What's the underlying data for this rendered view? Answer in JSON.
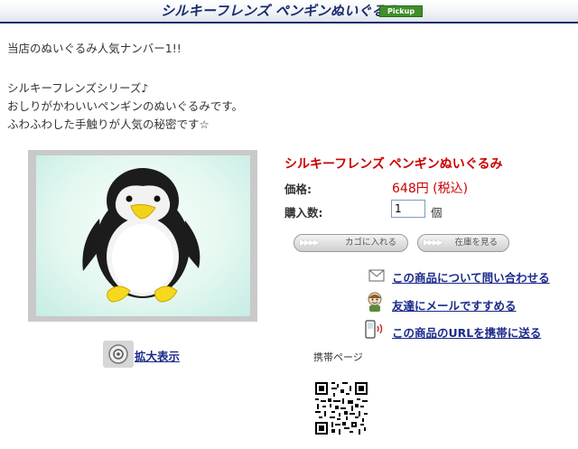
{
  "header": {
    "title": "シルキーフレンズ ペンギンぬいぐるみ",
    "badge": "Pickup"
  },
  "intro": {
    "line1": "当店のぬいぐるみ人気ナンバー1!!",
    "line2": "シルキーフレンズシリーズ♪",
    "line3": "おしりがかわいいペンギンのぬいぐるみです。",
    "line4": "ふわふわした手触りが人気の秘密です☆"
  },
  "product": {
    "name": "シルキーフレンズ ペンギンぬいぐるみ",
    "price_label": "価格:",
    "price_value": "648円 (税込)",
    "qty_label": "購入数:",
    "qty_value": "1",
    "qty_unit": "個"
  },
  "buttons": {
    "cart": "カゴに入れる",
    "stock": "在庫を見る"
  },
  "links": {
    "inquiry": "この商品について問い合わせる",
    "recommend": "友達にメールですすめる",
    "mobile_url": "この商品のURLを携帯に送る",
    "zoom": "拡大表示"
  },
  "mobile": {
    "label": "携帯ページ"
  },
  "colors": {
    "header_navy": "#1a2c6e",
    "badge_green": "#3f8f2a",
    "price_red": "#cc0000",
    "link_blue": "#1a2a8a"
  },
  "icons": [
    "envelope-icon",
    "person-icon",
    "mobile-phone-icon",
    "zoom-magnifier-icon",
    "qr-code-icon"
  ]
}
